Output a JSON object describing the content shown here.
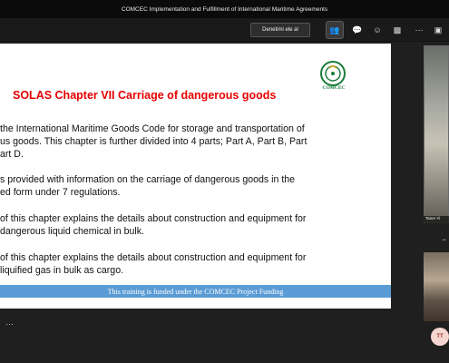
{
  "window": {
    "title": "COMCEC Implementation and Fulfillment of International Maritime Agreements"
  },
  "toolbar": {
    "take_control_label": "Denetimi ele al"
  },
  "slide": {
    "title": "SOLAS Chapter VII    Carriage of dangerous goods",
    "logo_text": "COMCEC",
    "paragraphs": [
      [
        "the International Maritime Goods Code for storage and transportation of",
        "us goods. This chapter is further divided into 4 parts; Part A, Part B, Part",
        "art D."
      ],
      [
        "s provided with information on the carriage of dangerous goods in the",
        "ed form under 7 regulations."
      ],
      [
        "of this chapter explains the details about construction and equipment for",
        "dangerous liquid chemical in bulk."
      ],
      [
        "of this chapter explains the details about construction and equipment for",
        "liquified gas in bulk as cargo."
      ]
    ],
    "footer": "This training is funded under the COMCEC Project Funding"
  },
  "stage": {
    "more_label": "…"
  },
  "participants": {
    "video1_name": "Taner Yi",
    "avatar_initials": "TT"
  },
  "colors": {
    "title_red": "#e60000",
    "footer_blue": "#5a9bd5",
    "logo_green": "#1a7d3c"
  }
}
